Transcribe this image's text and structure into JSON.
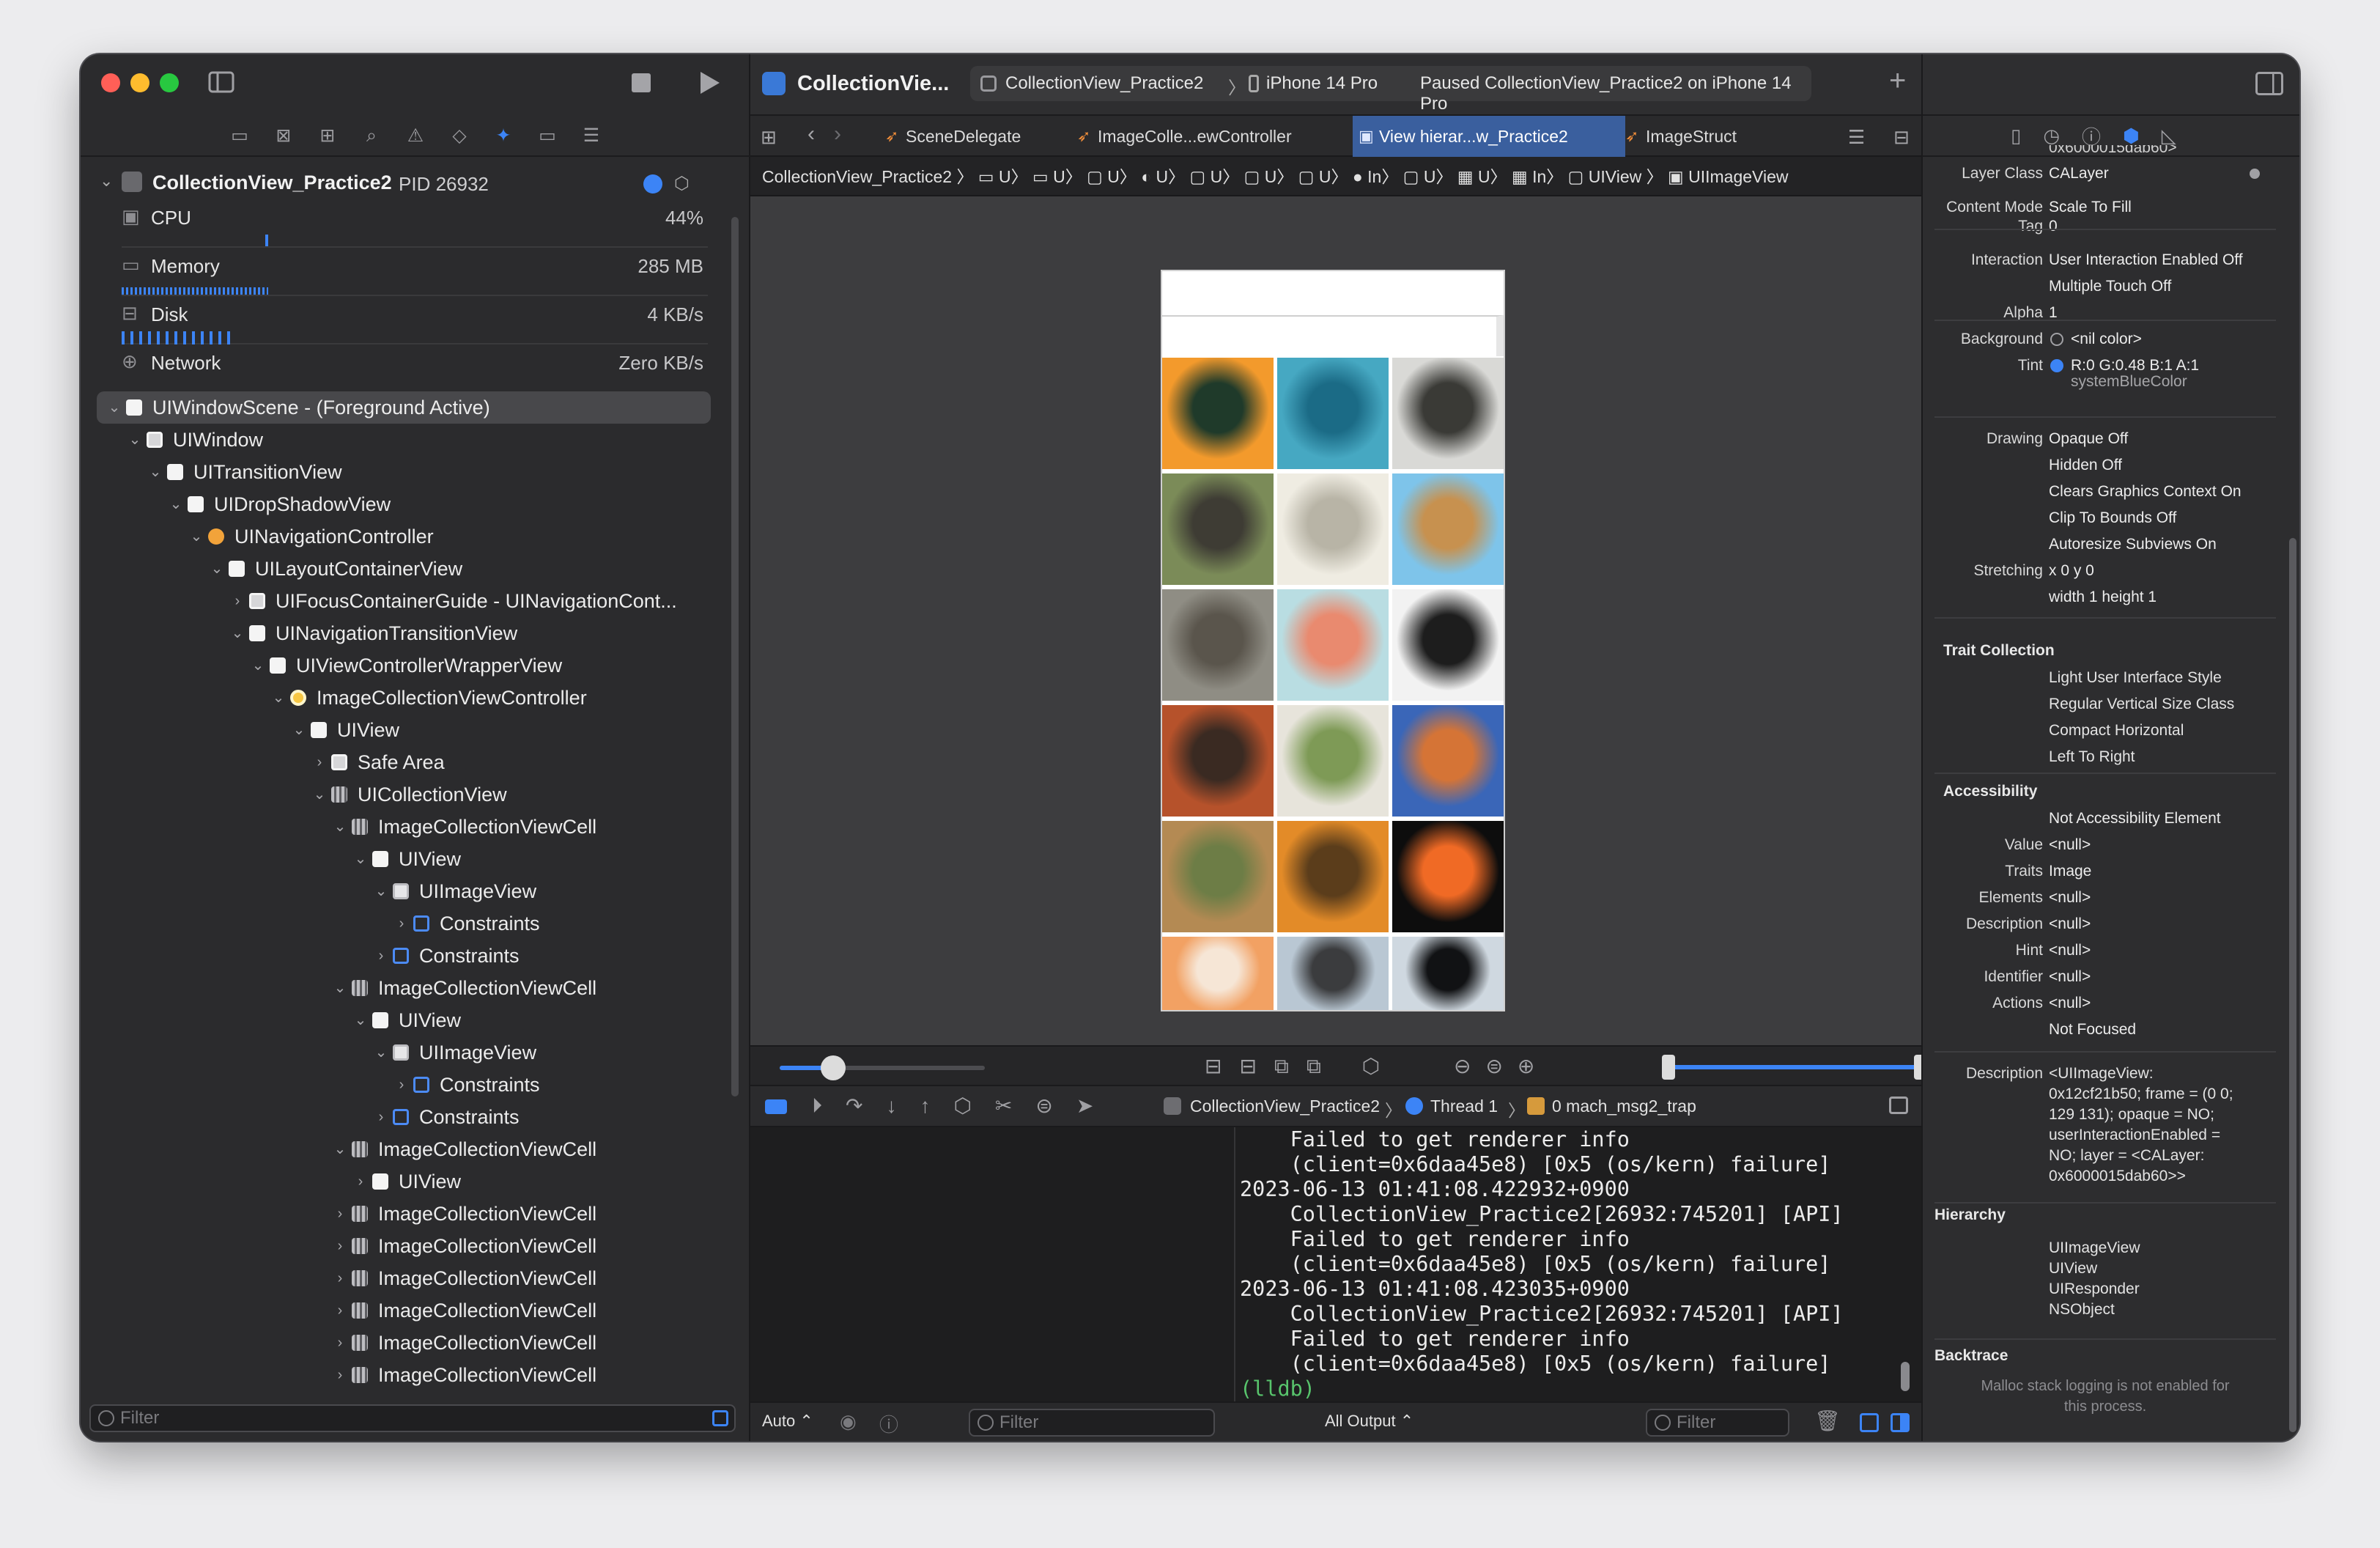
{
  "window": {
    "colors": {
      "close": "#ff5f57",
      "minimize": "#febc2e",
      "zoom": "#28c840",
      "accent": "#3c84f6"
    }
  },
  "toolbar": {
    "app_title": "CollectionVie...",
    "scheme": "CollectionView_Practice2",
    "destination": "iPhone 14 Pro",
    "status": "Paused CollectionView_Practice2 on iPhone 14 Pro",
    "add": "+"
  },
  "debug_nav": {
    "process": "CollectionView_Practice2",
    "pid": "PID 26932",
    "gauges": [
      {
        "label": "CPU",
        "value": "44%",
        "icon": "cpu-icon"
      },
      {
        "label": "Memory",
        "value": "285 MB",
        "icon": "memory-icon"
      },
      {
        "label": "Disk",
        "value": "4 KB/s",
        "icon": "disk-icon"
      },
      {
        "label": "Network",
        "value": "Zero KB/s",
        "icon": "network-icon"
      }
    ],
    "filter_placeholder": "Filter"
  },
  "tree": [
    {
      "label": "UIWindowScene - (Foreground Active)",
      "depth": 0,
      "icon": "w",
      "chev": "v",
      "sel": true
    },
    {
      "label": "UIWindow",
      "depth": 1,
      "icon": "ws",
      "chev": "v"
    },
    {
      "label": "UITransitionView",
      "depth": 2,
      "icon": "w",
      "chev": "v"
    },
    {
      "label": "UIDropShadowView",
      "depth": 3,
      "icon": "w",
      "chev": "v"
    },
    {
      "label": "UINavigationController",
      "depth": 4,
      "icon": "o",
      "chev": "v"
    },
    {
      "label": "UILayoutContainerView",
      "depth": 5,
      "icon": "w",
      "chev": "v"
    },
    {
      "label": "UIFocusContainerGuide - UINavigationCont...",
      "depth": 6,
      "icon": "ws",
      "chev": ">"
    },
    {
      "label": "UINavigationTransitionView",
      "depth": 6,
      "icon": "w",
      "chev": "v"
    },
    {
      "label": "UIViewControllerWrapperView",
      "depth": 7,
      "icon": "w",
      "chev": "v"
    },
    {
      "label": "ImageCollectionViewController",
      "depth": 8,
      "icon": "y",
      "chev": "v"
    },
    {
      "label": "UIView",
      "depth": 9,
      "icon": "w",
      "chev": "v"
    },
    {
      "label": "Safe Area",
      "depth": 10,
      "icon": "ws",
      "chev": ">"
    },
    {
      "label": "UICollectionView",
      "depth": 10,
      "icon": "g",
      "chev": "v"
    },
    {
      "label": "ImageCollectionViewCell",
      "depth": 11,
      "icon": "g",
      "chev": "v"
    },
    {
      "label": "UIView",
      "depth": 12,
      "icon": "w",
      "chev": "v"
    },
    {
      "label": "UIImageView",
      "depth": 13,
      "icon": "im",
      "chev": "v"
    },
    {
      "label": "Constraints",
      "depth": 14,
      "icon": "b",
      "chev": ">"
    },
    {
      "label": "Constraints",
      "depth": 13,
      "icon": "b",
      "chev": ">"
    },
    {
      "label": "ImageCollectionViewCell",
      "depth": 11,
      "icon": "g",
      "chev": "v"
    },
    {
      "label": "UIView",
      "depth": 12,
      "icon": "w",
      "chev": "v"
    },
    {
      "label": "UIImageView",
      "depth": 13,
      "icon": "im",
      "chev": "v"
    },
    {
      "label": "Constraints",
      "depth": 14,
      "icon": "b",
      "chev": ">"
    },
    {
      "label": "Constraints",
      "depth": 13,
      "icon": "b",
      "chev": ">"
    },
    {
      "label": "ImageCollectionViewCell",
      "depth": 11,
      "icon": "g",
      "chev": "v"
    },
    {
      "label": "UIView",
      "depth": 12,
      "icon": "w",
      "chev": ">"
    },
    {
      "label": "ImageCollectionViewCell",
      "depth": 11,
      "icon": "g",
      "chev": ">"
    },
    {
      "label": "ImageCollectionViewCell",
      "depth": 11,
      "icon": "g",
      "chev": ">"
    },
    {
      "label": "ImageCollectionViewCell",
      "depth": 11,
      "icon": "g",
      "chev": ">"
    },
    {
      "label": "ImageCollectionViewCell",
      "depth": 11,
      "icon": "g",
      "chev": ">"
    },
    {
      "label": "ImageCollectionViewCell",
      "depth": 11,
      "icon": "g",
      "chev": ">"
    },
    {
      "label": "ImageCollectionViewCell",
      "depth": 11,
      "icon": "g",
      "chev": ">"
    }
  ],
  "tabs": [
    "SceneDelegate",
    "ImageColle...ewController",
    "View hierar...w_Practice2",
    "ImageStruct"
  ],
  "jumpbar": "CollectionView_Practice2 〉 ▭ U〉 ▭ U〉 ▢ U〉 ◐ U〉 ▢ U〉 ▢ U〉 ▢ U〉 ● In〉 ▢ U〉 ▦ U〉 ▦ In〉 ▢ UIView 〉 ▣ UIImageView",
  "cells": [
    {
      "name": "parrot",
      "c1": "#f39a2c",
      "c2": "#1f3a2a"
    },
    {
      "name": "sea-turtle",
      "c1": "#46a8c2",
      "c2": "#1b6b86"
    },
    {
      "name": "white-tiger",
      "c1": "#d9d9d6",
      "c2": "#3a3a36"
    },
    {
      "name": "raccoon",
      "c1": "#7b8b58",
      "c2": "#3e3c34"
    },
    {
      "name": "polar-bear",
      "c1": "#efece2",
      "c2": "#b8b4a6"
    },
    {
      "name": "giraffe",
      "c1": "#7ec4ea",
      "c2": "#c7914f"
    },
    {
      "name": "elephants",
      "c1": "#8f8d84",
      "c2": "#5a554c"
    },
    {
      "name": "flamingo",
      "c1": "#b9dde2",
      "c2": "#e98a6f"
    },
    {
      "name": "zebra",
      "c1": "#f2f2f2",
      "c2": "#1d1d1d"
    },
    {
      "name": "red-panda",
      "c1": "#b6522b",
      "c2": "#3a2a22"
    },
    {
      "name": "sheep",
      "c1": "#e7e4db",
      "c2": "#7e9a56"
    },
    {
      "name": "fox",
      "c1": "#3a66b8",
      "c2": "#d57436"
    },
    {
      "name": "lion",
      "c1": "#b48a53",
      "c2": "#6d7d46"
    },
    {
      "name": "butterfly",
      "c1": "#e38b28",
      "c2": "#5b3d1b"
    },
    {
      "name": "goldfish",
      "c1": "#0d0d0d",
      "c2": "#f06a25"
    },
    {
      "name": "corgi",
      "c1": "#f2a163",
      "c2": "#f6e6d6"
    },
    {
      "name": "eagle",
      "c1": "#b9c7d3",
      "c2": "#3b3c3e"
    },
    {
      "name": "puffin",
      "c1": "#cfd8e0",
      "c2": "#111214"
    }
  ],
  "debugbar": {
    "scheme": "CollectionView_Practice2",
    "thread": "Thread 1",
    "frame": "0 mach_msg2_trap"
  },
  "console_lines": [
    "    Failed to get renderer info",
    "    (client=0x6daa45e8) [0x5 (os/kern) failure]",
    "2023-06-13 01:41:08.422932+0900",
    "    CollectionView_Practice2[26932:745201] [API]",
    "    Failed to get renderer info",
    "    (client=0x6daa45e8) [0x5 (os/kern) failure]",
    "2023-06-13 01:41:08.423035+0900",
    "    CollectionView_Practice2[26932:745201] [API]",
    "    Failed to get renderer info",
    "    (client=0x6daa45e8) [0x5 (os/kern) failure]"
  ],
  "prompt": "(lldb)",
  "bottom": {
    "auto": "Auto ⌃",
    "filter": "Filter",
    "all_output": "All Output ⌃",
    "filter2": "Filter"
  },
  "inspector": {
    "top_clip": "0x6000015dab60>",
    "rows": [
      {
        "k": "Layer Class",
        "v": "CALayer"
      },
      {
        "k": "Content Mode",
        "v": "Scale To Fill"
      },
      {
        "k": "Tag",
        "v": "0"
      },
      {
        "k": "Interaction",
        "v": "User Interaction Enabled Off"
      },
      {
        "k": "",
        "v": "Multiple Touch Off"
      },
      {
        "k": "Alpha",
        "v": "1"
      },
      {
        "k": "Background",
        "v": "<nil color>"
      },
      {
        "k": "Tint",
        "v": "R:0 G:0.48 B:1 A:1"
      },
      {
        "k": "",
        "v": "systemBlueColor"
      },
      {
        "k": "Drawing",
        "v": "Opaque Off"
      },
      {
        "k": "",
        "v": "Hidden Off"
      },
      {
        "k": "",
        "v": "Clears Graphics Context On"
      },
      {
        "k": "",
        "v": "Clip To Bounds Off"
      },
      {
        "k": "",
        "v": "Autoresize Subviews On"
      },
      {
        "k": "Stretching",
        "v": "x 0          y 0"
      },
      {
        "k": "",
        "v": "width 1    height 1"
      }
    ],
    "trait_title": "Trait Collection",
    "traits": [
      "Light User Interface Style",
      "Regular Vertical Size Class",
      "Compact Horizontal",
      "Left To Right"
    ],
    "acc_title": "Accessibility",
    "acc": [
      {
        "k": "",
        "v": "Not Accessibility Element"
      },
      {
        "k": "Value",
        "v": "<null>"
      },
      {
        "k": "Traits",
        "v": "Image"
      },
      {
        "k": "Elements",
        "v": "<null>"
      },
      {
        "k": "Description",
        "v": "<null>"
      },
      {
        "k": "Hint",
        "v": "<null>"
      },
      {
        "k": "Identifier",
        "v": "<null>"
      },
      {
        "k": "Actions",
        "v": "<null>"
      },
      {
        "k": "",
        "v": "Not Focused"
      }
    ],
    "desc_key": "Description",
    "desc_lines": [
      "<UIImageView:",
      "0x12cf21b50; frame = (0 0;",
      "129 131); opaque = NO;",
      "userInteractionEnabled =",
      "NO; layer = <CALayer:",
      "0x6000015dab60>>"
    ],
    "hierarchy_title": "Hierarchy",
    "hierarchy": [
      "UIImageView",
      "UIView",
      "UIResponder",
      "NSObject"
    ],
    "backtrace_title": "Backtrace",
    "backtrace_note1": "Malloc stack logging is not enabled for",
    "backtrace_note2": "this process."
  }
}
